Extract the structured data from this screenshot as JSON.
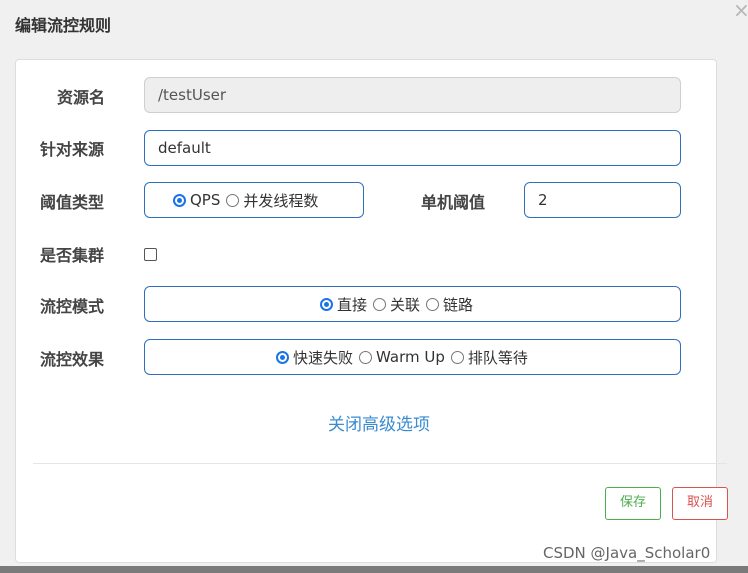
{
  "dialog": {
    "title": "编辑流控规则",
    "close": "×"
  },
  "form": {
    "resource": {
      "label": "资源名",
      "value": "/testUser"
    },
    "limitApp": {
      "label": "针对来源",
      "value": "default"
    },
    "grade": {
      "label": "阈值类型",
      "options": [
        "QPS",
        "并发线程数"
      ],
      "selected": "QPS"
    },
    "count": {
      "label": "单机阈值",
      "value": "2"
    },
    "cluster": {
      "label": "是否集群",
      "checked": false
    },
    "strategy": {
      "label": "流控模式",
      "options": [
        "直接",
        "关联",
        "链路"
      ],
      "selected": "直接"
    },
    "controlBehavior": {
      "label": "流控效果",
      "options": [
        "快速失败",
        "Warm Up",
        "排队等待"
      ],
      "selected": "快速失败"
    },
    "advanced_link": "关闭高级选项"
  },
  "footer": {
    "save_label": "保存",
    "cancel_label": "取消"
  },
  "watermark": "CSDN @Java_Scholar0",
  "colors": {
    "primary": "#2f6fbf",
    "success": "#4cae4c",
    "danger": "#d9534f",
    "link": "#3a8bd1"
  }
}
